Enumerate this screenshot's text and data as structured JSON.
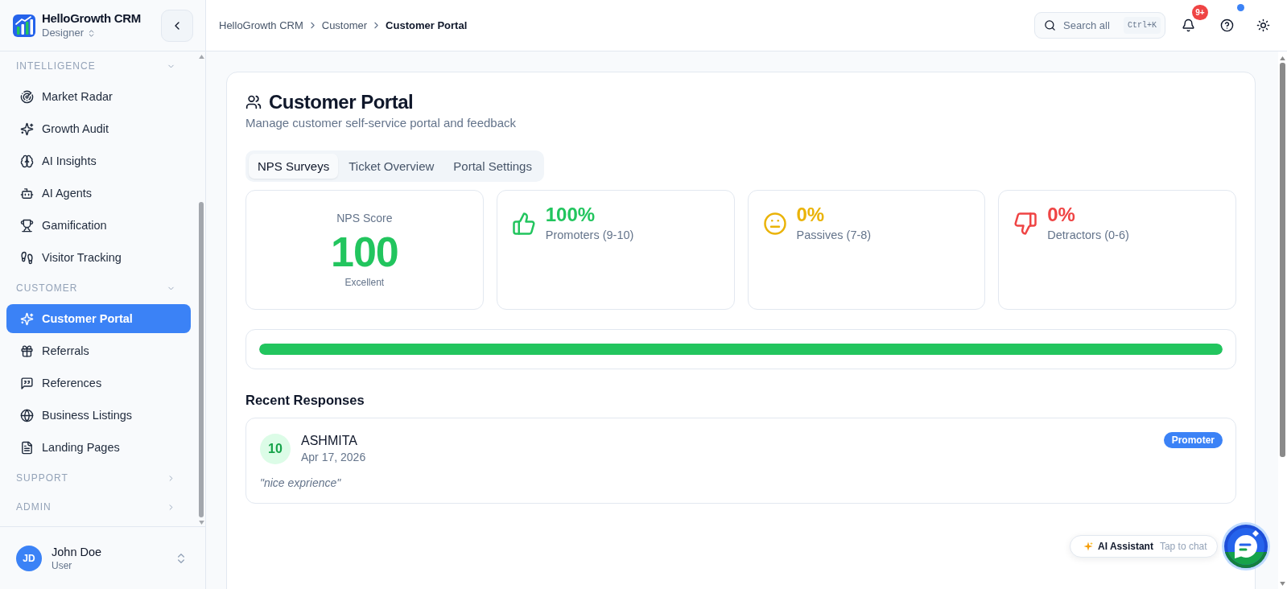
{
  "app": {
    "name": "HelloGrowth CRM",
    "workspace": "Designer"
  },
  "sidebar": {
    "sections": [
      {
        "title": "INTELLIGENCE",
        "expanded": true,
        "items": [
          {
            "label": "Market Radar",
            "selected": false
          },
          {
            "label": "Growth Audit",
            "selected": false
          },
          {
            "label": "AI Insights",
            "selected": false
          },
          {
            "label": "AI Agents",
            "selected": false
          },
          {
            "label": "Gamification",
            "selected": false
          },
          {
            "label": "Visitor Tracking",
            "selected": false
          }
        ]
      },
      {
        "title": "CUSTOMER",
        "expanded": true,
        "items": [
          {
            "label": "Customer Portal",
            "selected": true
          },
          {
            "label": "Referrals",
            "selected": false
          },
          {
            "label": "References",
            "selected": false
          },
          {
            "label": "Business Listings",
            "selected": false
          },
          {
            "label": "Landing Pages",
            "selected": false
          }
        ]
      },
      {
        "title": "SUPPORT",
        "expanded": false
      },
      {
        "title": "ADMIN",
        "expanded": false
      }
    ],
    "user": {
      "initials": "JD",
      "name": "John Doe",
      "role": "User"
    }
  },
  "header": {
    "breadcrumb": [
      "HelloGrowth CRM",
      "Customer",
      "Customer Portal"
    ],
    "search": {
      "placeholder": "Search all",
      "shortcut": "Ctrl+K"
    },
    "notifications": {
      "badge": "9+"
    },
    "help": {
      "unread": true
    }
  },
  "page": {
    "title": "Customer Portal",
    "subtitle": "Manage customer self-service portal and feedback",
    "tabs": [
      {
        "label": "NPS Surveys",
        "selected": true
      },
      {
        "label": "Ticket Overview",
        "selected": false
      },
      {
        "label": "Portal Settings",
        "selected": false
      }
    ],
    "nps": {
      "label": "NPS Score",
      "value": "100",
      "rating": "Excellent"
    },
    "breakdown": [
      {
        "kind": "promoters",
        "value": "100%",
        "label": "Promoters (9-10)",
        "color": "#22c55e"
      },
      {
        "kind": "passives",
        "value": "0%",
        "label": "Passives (7-8)",
        "color": "#eab308"
      },
      {
        "kind": "detractors",
        "value": "0%",
        "label": "Detractors (0-6)",
        "color": "#ef4444"
      }
    ],
    "score_bar": {
      "level": 1
    },
    "recent_responses": {
      "title": "Recent Responses",
      "items": [
        {
          "score": "10",
          "name": "ASHMITA",
          "date": "Apr 17, 2026",
          "category": "Promoter",
          "comment": "\"nice exprience\""
        }
      ]
    }
  },
  "assistant": {
    "label": "AI Assistant",
    "hint": "Tap to chat"
  }
}
